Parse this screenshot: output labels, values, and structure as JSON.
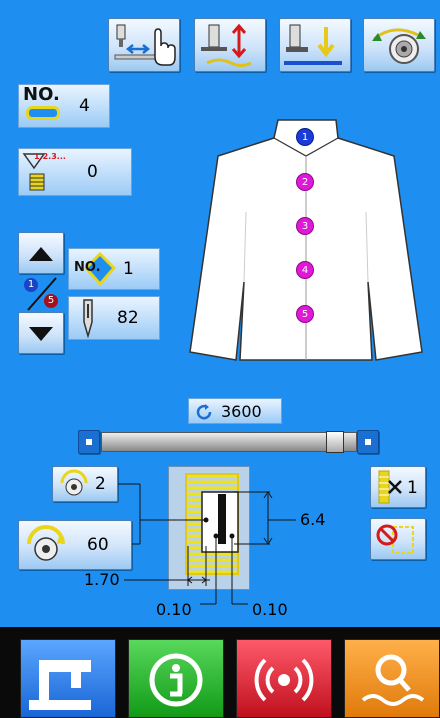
{
  "toolbar": {
    "buttons": [
      {
        "name": "needle-position-button",
        "icon": "needle-hand-icon"
      },
      {
        "name": "thread-tension-button",
        "icon": "presser-lift-icon"
      },
      {
        "name": "presser-down-button",
        "icon": "presser-down-icon"
      },
      {
        "name": "bobbin-winder-button",
        "icon": "bobbin-icon"
      }
    ]
  },
  "pattern_no": {
    "label": "NO.",
    "value": "4"
  },
  "counter": {
    "value": "0",
    "badge": "1.2.3..."
  },
  "step_nav": {
    "current": "1",
    "total": "5"
  },
  "buttonhole_no": {
    "label": "NO.",
    "value": "1"
  },
  "needle_value": "82",
  "shirt_buttons": [
    "1",
    "2",
    "3",
    "4",
    "5"
  ],
  "speed": {
    "value": "3600",
    "level": 0.94
  },
  "small_dial": {
    "value": "2"
  },
  "large_dial": {
    "value": "60"
  },
  "cross": {
    "value": "1"
  },
  "dims": {
    "length": "6.4",
    "width_left": "1.70",
    "gap_a": "0.10",
    "gap_b": "0.10"
  },
  "colors": {
    "background": "#1e8ff0",
    "home": "#2f7de0",
    "info": "#19b81f",
    "alarm": "#e0182a",
    "search": "#ef8a12"
  }
}
